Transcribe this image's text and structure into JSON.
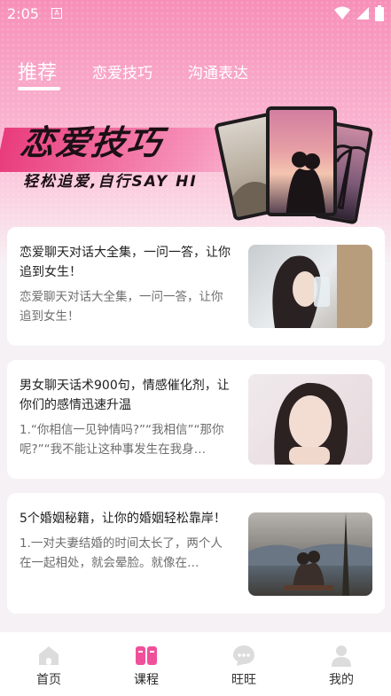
{
  "status_bar": {
    "time": "2:05",
    "a_badge": "A"
  },
  "tabs": [
    {
      "label": "推荐",
      "active": true
    },
    {
      "label": "恋爱技巧",
      "active": false
    },
    {
      "label": "沟通表达",
      "active": false
    }
  ],
  "banner": {
    "title": "恋爱技巧",
    "subtitle": "轻松追爱,自行SAY  HI"
  },
  "articles": [
    {
      "title": "恋爱聊天对话大全集，一问一答，让你追到女生！",
      "summary": "恋爱聊天对话大全集，一问一答，让你追到女生！"
    },
    {
      "title": "男女聊天话术900句，情感催化剂，让你们的感情迅速升温",
      "summary": "1.“你相信一见钟情吗?”“我相信”“那你呢?”“我不能让这种事发生在我身…"
    },
    {
      "title": "5个婚姻秘籍，让你的婚姻轻松靠岸！",
      "summary": "1.一对夫妻结婚的时间太长了，两个人在一起相处，就会晕脸。就像在…"
    }
  ],
  "bottom_nav": [
    {
      "label": "首页",
      "icon": "home-icon",
      "active": false
    },
    {
      "label": "课程",
      "icon": "book-icon",
      "active": true
    },
    {
      "label": "旺旺",
      "icon": "chat-icon",
      "active": false
    },
    {
      "label": "我的",
      "icon": "profile-icon",
      "active": false
    }
  ],
  "colors": {
    "accent": "#f0509a",
    "inactive_icon": "#dcdcdc",
    "header_pink": "#f78fb9"
  }
}
